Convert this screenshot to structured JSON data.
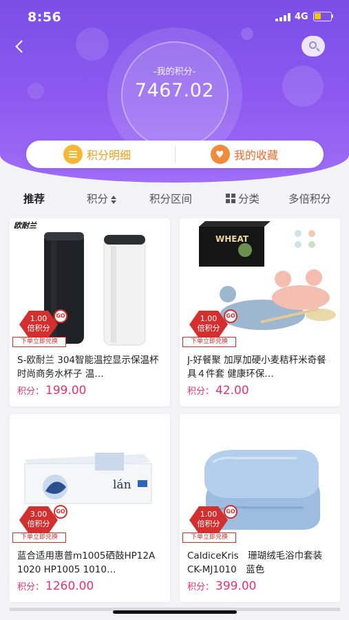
{
  "status_bar": {
    "time": "8:56",
    "network": "4G"
  },
  "header": {
    "points_label": "-我的积分-",
    "points_value": "7467.02"
  },
  "actions": [
    {
      "label": "积分明细",
      "icon": "list-icon"
    },
    {
      "label": "我的收藏",
      "icon": "heart-icon"
    }
  ],
  "tabs": [
    {
      "label": "推荐",
      "active": true
    },
    {
      "label": "积分",
      "icon": "sort-icon"
    },
    {
      "label": "积分区间"
    },
    {
      "label": "分类",
      "icon": "grid-icon"
    },
    {
      "label": "多倍积分"
    }
  ],
  "products": [
    {
      "title": "S-欧耐兰 304智能温控显示保温杯时尚商务水杯子 温…",
      "price_label": "积分：",
      "price": "199.00",
      "multiplier": "1.00",
      "multiplier_unit": "倍积分",
      "ribbon": "下单立即兑换",
      "go": "GO",
      "brand_text": "欧耐兰"
    },
    {
      "title": "J-好餐聚 加厚加硬小麦秸秆米奇餐具４件套 健康环保…",
      "price_label": "积分：",
      "price": "42.00",
      "multiplier": "1.00",
      "multiplier_unit": "倍积分",
      "ribbon": "下单立即兑换",
      "go": "GO",
      "brand_text": "WHEAT"
    },
    {
      "title": "蓝合适用惠普m1005硒鼓HP12A 1020 HP1005 1010…",
      "price_label": "积分：",
      "price": "1260.00",
      "multiplier": "3.00",
      "multiplier_unit": "倍积分",
      "ribbon": "下单立即兑换",
      "go": "GO",
      "brand_text": "lán"
    },
    {
      "title": "CaldiceKris　珊瑚绒毛浴巾套装 CK-MJ1010　蓝色",
      "price_label": "积分：",
      "price": "399.00",
      "multiplier": "1.00",
      "multiplier_unit": "倍积分",
      "ribbon": "下单立即兑换",
      "go": "GO"
    }
  ],
  "colors": {
    "header": "#8d5af0",
    "price": "#e3356b",
    "badge": "#d32f2f"
  }
}
